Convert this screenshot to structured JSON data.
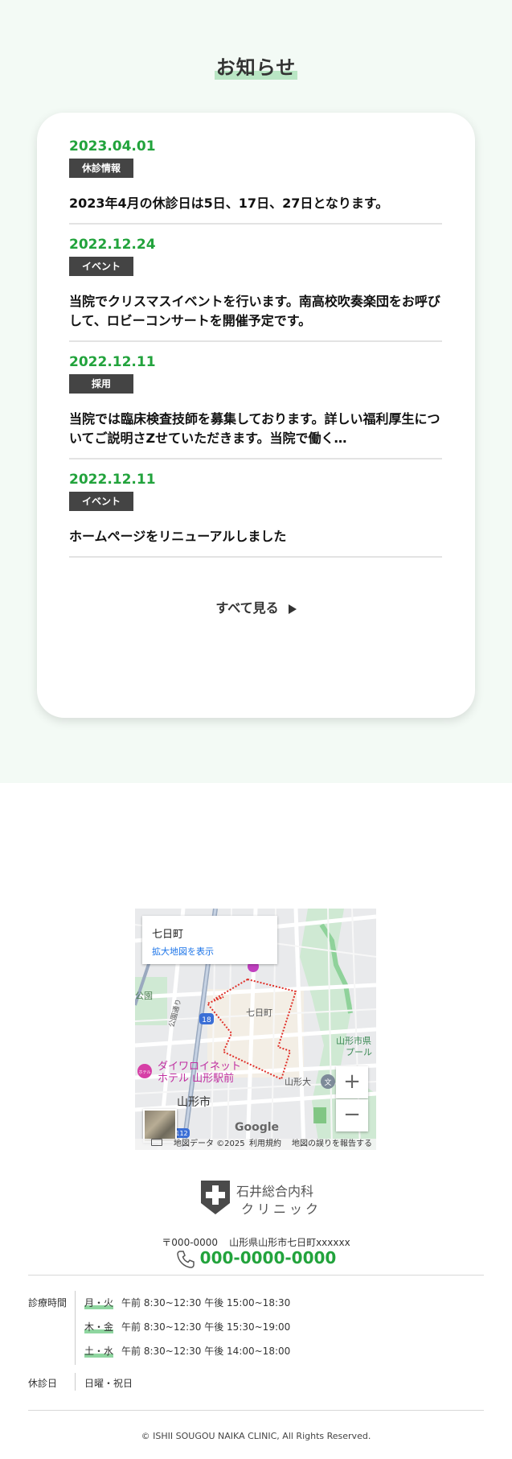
{
  "news": {
    "title": "お知らせ",
    "items": [
      {
        "date": "2023.04.01",
        "tag": "休診情報",
        "text": "2023年4月の休診日は5日、17日、27日となります。"
      },
      {
        "date": "2022.12.24",
        "tag": "イベント",
        "text": "当院でクリスマスイベントを行います。南高校吹奏楽団をお呼びして、ロビーコンサートを開催予定です。"
      },
      {
        "date": "2022.12.11",
        "tag": "採用",
        "text": "当院では臨床検査技師を募集しております。詳しい福利厚生についてご説明さZせていただきます。当院で働く…"
      },
      {
        "date": "2022.12.11",
        "tag": "イベント",
        "text": "ホームページをリニューアルしました"
      }
    ],
    "see_all": "すべて見る"
  },
  "map": {
    "place_name": "七日町",
    "view_larger": "拡大地図を表示",
    "zoom_in": "+",
    "zoom_out": "−",
    "labels": {
      "nanokamachi": "七日町",
      "hotel_line1": "ダイワロイネット",
      "hotel_line2": "ホテル 山形駅前",
      "city": "山形市",
      "park": "公園",
      "koen_dori": "公園通り",
      "route": "18",
      "route2": "112",
      "pool_line1": "山形市県",
      "pool_line2": "プール",
      "yamagata_dai": "山形大",
      "school_glyph": "文",
      "hotel_glyph": "ホテル",
      "google": "Google"
    },
    "attribution": {
      "data": "地図データ ©2025",
      "terms": "利用規約",
      "report": "地図の誤りを報告する"
    }
  },
  "footer": {
    "logo_line1": "石井総合内科",
    "logo_line2": "クリニック",
    "postal": "〒000-0000",
    "address": "山形県山形市七日町xxxxxx",
    "phone": "000-0000-0000",
    "hours_label": "診療時間",
    "hours": [
      {
        "days": "月・火",
        "time": "午前 8:30~12:30 午後 15:00~18:30"
      },
      {
        "days": "木・金",
        "time": "午前 8:30~12:30 午後 15:30~19:00"
      },
      {
        "days": "土・水",
        "time": "午前 8:30~12:30 午後 14:00~18:00"
      }
    ],
    "closed_label": "休診日",
    "closed_days": "日曜・祝日",
    "copyright": "© ISHII SOUGOU NAIKA CLINIC, All Rights Reserved."
  },
  "colors": {
    "accent_green": "#22a33c",
    "tag_bg": "#444444",
    "section_bg": "#f3faf5"
  }
}
